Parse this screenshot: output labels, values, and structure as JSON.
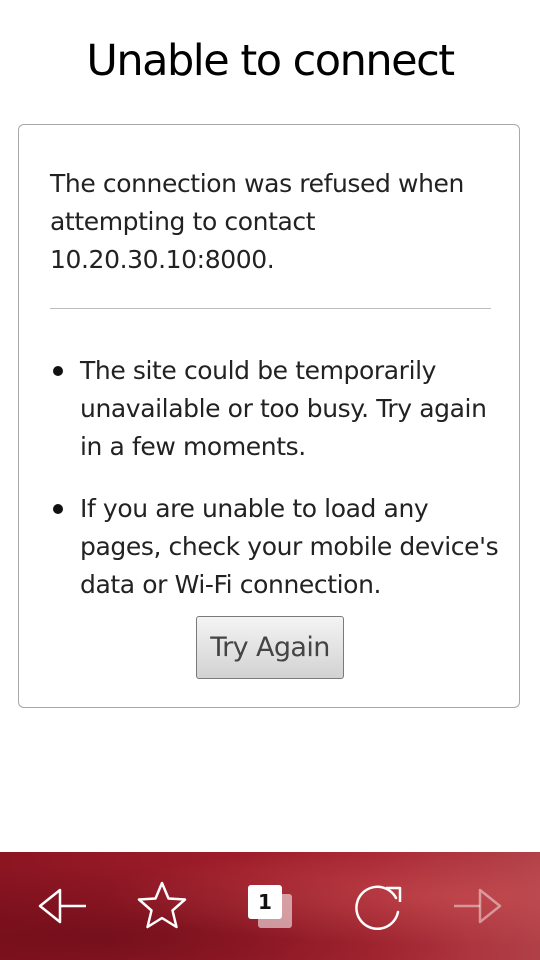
{
  "error_page": {
    "title": "Unable to connect",
    "description": "The connection was refused when attempting to contact 10.20.30.10:8000.",
    "tips": [
      "The site could be temporarily unavailable or too busy. Try again in a few moments.",
      "If you are unable to load any pages, check your mobile device's data or Wi-Fi connection."
    ],
    "try_again_label": "Try Again"
  },
  "toolbar": {
    "tab_count": "1",
    "icons": [
      "back-arrow-icon",
      "bookmark-star-icon",
      "tabs-icon",
      "reload-icon",
      "forward-arrow-icon"
    ],
    "accent_color": "#9e1d2a",
    "forward_enabled": false
  }
}
